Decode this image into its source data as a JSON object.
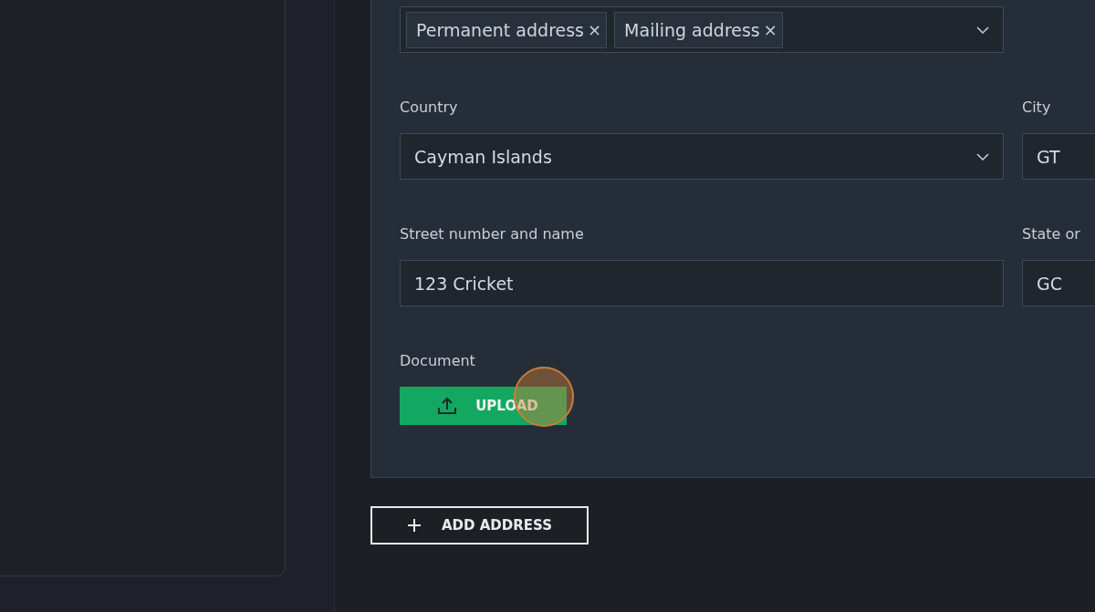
{
  "address_types": {
    "tags": [
      {
        "label": "Permanent address",
        "remove": "×"
      },
      {
        "label": "Mailing address",
        "remove": "×"
      }
    ]
  },
  "fields": [
    {
      "label": "Country",
      "value": "Cayman Islands",
      "kind": "select"
    },
    {
      "label": "City",
      "value": "GT",
      "kind": "text"
    },
    {
      "label": "Street number and name",
      "value": "123 Cricket",
      "kind": "text"
    },
    {
      "label": "State or",
      "value": "GC",
      "kind": "text"
    }
  ],
  "document": {
    "label": "Document",
    "button": "UPLOAD"
  },
  "add_button": "ADD ADDRESS"
}
